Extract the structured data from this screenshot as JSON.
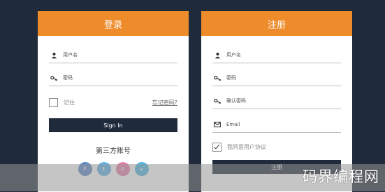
{
  "login": {
    "title": "登录",
    "username_placeholder": "用户名",
    "password_placeholder": "密码",
    "remember_label": "记住",
    "forgot_label": "忘记密码?",
    "submit_label": "Sign In",
    "third_party_title": "第三方账号",
    "socials": [
      {
        "name": "facebook-icon",
        "glyph": "f",
        "color": "#5b86c5"
      },
      {
        "name": "twitter-icon",
        "glyph": "t",
        "color": "#5db2e8"
      },
      {
        "name": "dribbble-icon",
        "glyph": "◎",
        "color": "#e97ea7"
      },
      {
        "name": "vimeo-icon",
        "glyph": "v",
        "color": "#4fb7e0"
      }
    ]
  },
  "register": {
    "title": "注册",
    "username_placeholder": "用户名",
    "password_placeholder": "密码",
    "confirm_password_placeholder": "确认密码",
    "email_placeholder": "Email",
    "agree_label": "我同意用户协议",
    "submit_label": "注册"
  },
  "watermark": "码界编程网",
  "colors": {
    "accent": "#ee8c2c",
    "dark": "#1f2a3b"
  }
}
